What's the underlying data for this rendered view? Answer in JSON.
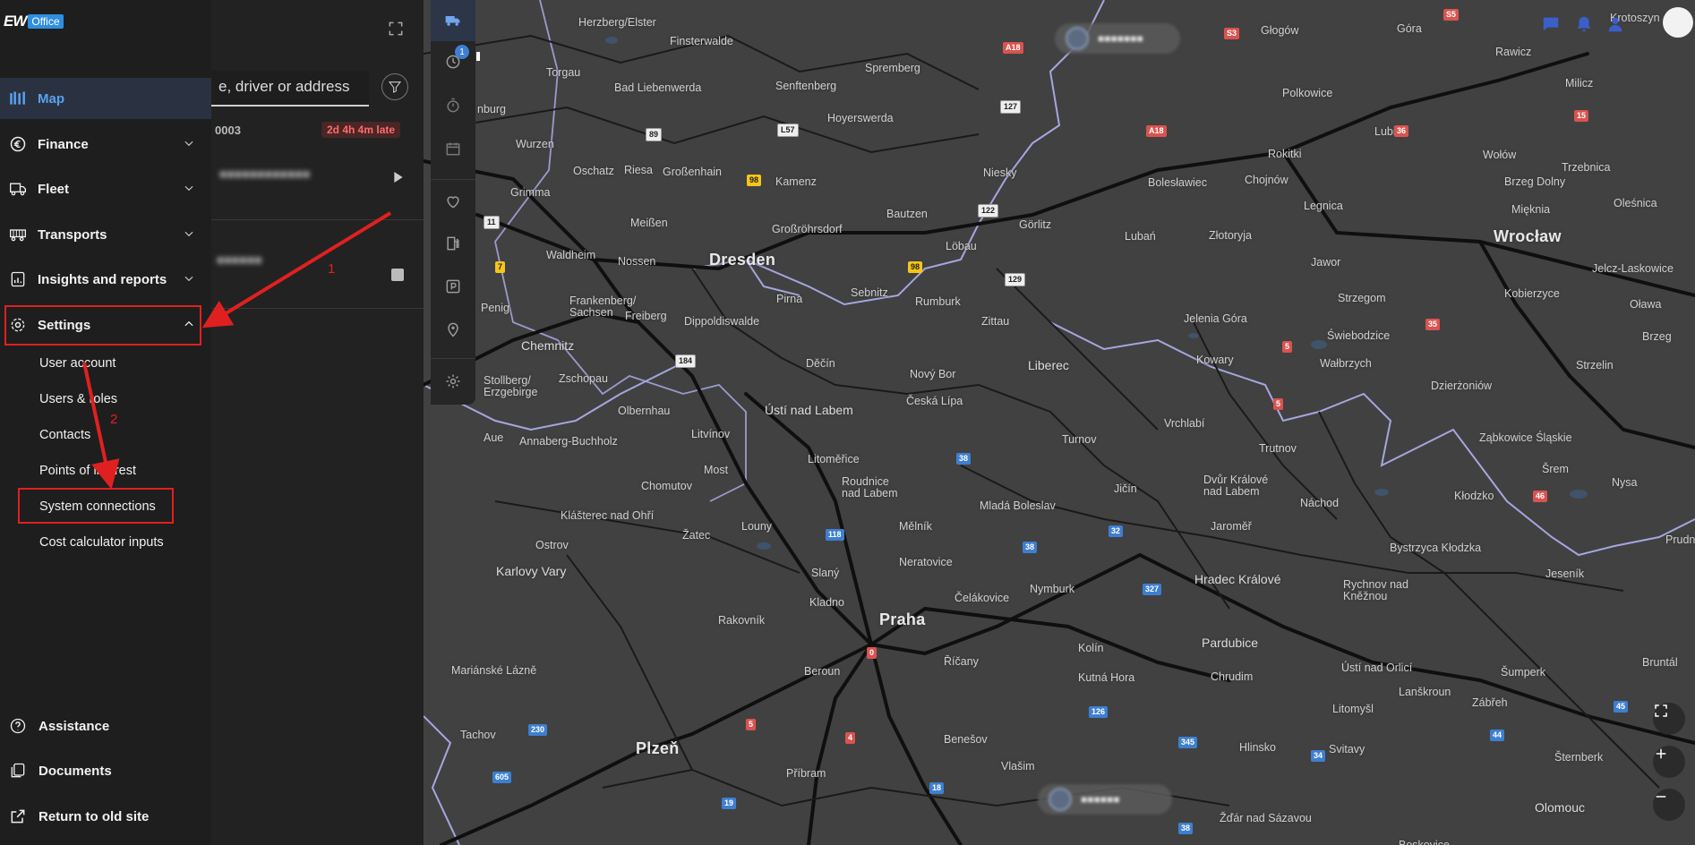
{
  "brand": {
    "logo_text": "EW",
    "product": "Office"
  },
  "sidebar": {
    "items": [
      {
        "id": "map",
        "label": "Map",
        "icon": "map-icon",
        "active": true
      },
      {
        "id": "finance",
        "label": "Finance",
        "icon": "euro-icon"
      },
      {
        "id": "fleet",
        "label": "Fleet",
        "icon": "truck-icon"
      },
      {
        "id": "transports",
        "label": "Transports",
        "icon": "trailer-icon"
      },
      {
        "id": "insights",
        "label": "Insights and reports",
        "icon": "report-icon"
      },
      {
        "id": "settings",
        "label": "Settings",
        "icon": "gear-icon",
        "expanded": true
      }
    ],
    "settings_sub": [
      "User account",
      "Users & roles",
      "Contacts",
      "Points of interest",
      "System connections",
      "Cost calculator inputs"
    ],
    "bottom": [
      {
        "label": "Assistance",
        "icon": "help-icon"
      },
      {
        "label": "Documents",
        "icon": "documents-icon"
      },
      {
        "label": "Return to old site",
        "icon": "external-link-icon"
      }
    ]
  },
  "panel": {
    "search_placeholder": "e, driver or address",
    "order_id": "0003",
    "late_badge": "2d 4h 4m late",
    "rail_badge": "1"
  },
  "annotations": {
    "step1": "1",
    "step2": "2"
  },
  "colors": {
    "accent": "#5aa0f0",
    "annotation": "#e02020",
    "badge_late": "#ff6b6b"
  },
  "map": {
    "cities": [
      [
        "Herzberg/Elster",
        646,
        19,
        ""
      ],
      [
        "Finsterwalde",
        748,
        40,
        ""
      ],
      [
        "Głogów",
        1408,
        28,
        ""
      ],
      [
        "Góra",
        1560,
        26,
        ""
      ],
      [
        "Krotoszyn",
        1798,
        14,
        ""
      ],
      [
        "Torgau",
        610,
        75,
        ""
      ],
      [
        "Bad Liebenwerda",
        686,
        92,
        ""
      ],
      [
        "Senftenberg",
        866,
        90,
        ""
      ],
      [
        "Spremberg",
        966,
        70,
        ""
      ],
      [
        "Rawicz",
        1670,
        52,
        ""
      ],
      [
        "Hoyerswerda",
        924,
        126,
        ""
      ],
      [
        "Polkowice",
        1432,
        98,
        ""
      ],
      [
        "Milicz",
        1748,
        87,
        ""
      ],
      [
        "nburg",
        533,
        116,
        ""
      ],
      [
        "Wurzen",
        576,
        155,
        ""
      ],
      [
        "Oschatz",
        640,
        185,
        ""
      ],
      [
        "Riesa",
        697,
        184,
        ""
      ],
      [
        "Großenhain",
        740,
        186,
        ""
      ],
      [
        "Kamenz",
        866,
        197,
        ""
      ],
      [
        "Niesky",
        1098,
        187,
        ""
      ],
      [
        "Bolesławiec",
        1282,
        198,
        ""
      ],
      [
        "Chojnów",
        1390,
        195,
        ""
      ],
      [
        "Rokitki",
        1416,
        166,
        ""
      ],
      [
        "Lubin",
        1535,
        141,
        ""
      ],
      [
        "Wołów",
        1656,
        167,
        ""
      ],
      [
        "Trzebnica",
        1744,
        181,
        ""
      ],
      [
        "Brzeg Dolny",
        1680,
        197,
        ""
      ],
      [
        "Oleśnica",
        1802,
        221,
        ""
      ],
      [
        "Grimma",
        570,
        209,
        ""
      ],
      [
        "Bautzen",
        990,
        233,
        ""
      ],
      [
        "Legnica",
        1456,
        224,
        ""
      ],
      [
        "Mięknia",
        1688,
        228,
        ""
      ],
      [
        "Meißen",
        704,
        243,
        ""
      ],
      [
        "Großröhrsdorf",
        862,
        250,
        ""
      ],
      [
        "Löbau",
        1056,
        269,
        ""
      ],
      [
        "Görlitz",
        1138,
        245,
        ""
      ],
      [
        "Lubań",
        1256,
        258,
        ""
      ],
      [
        "Złotoryja",
        1350,
        257,
        ""
      ],
      [
        "Waldheim",
        610,
        279,
        ""
      ],
      [
        "Nossen",
        690,
        286,
        ""
      ],
      [
        "Dresden",
        792,
        284,
        "big"
      ],
      [
        "Jawor",
        1464,
        287,
        ""
      ],
      [
        "Wrocław",
        1668,
        258,
        "big"
      ],
      [
        "Jelcz-Laskowice",
        1778,
        294,
        ""
      ],
      [
        "Pirna",
        867,
        328,
        ""
      ],
      [
        "Sebnitz",
        950,
        321,
        ""
      ],
      [
        "Rumburk",
        1022,
        331,
        ""
      ],
      [
        "Strzegom",
        1494,
        327,
        ""
      ],
      [
        "Kobierzyce",
        1680,
        322,
        ""
      ],
      [
        "Oława",
        1820,
        334,
        ""
      ],
      [
        "Frankenberg/\nSachsen",
        636,
        330,
        ""
      ],
      [
        "Freiberg",
        698,
        347,
        ""
      ],
      [
        "Dippoldiswalde",
        764,
        353,
        ""
      ],
      [
        "Zittau",
        1096,
        353,
        ""
      ],
      [
        "Jelenia Góra",
        1322,
        350,
        ""
      ],
      [
        "Świebodzice",
        1482,
        369,
        ""
      ],
      [
        "Brzeg",
        1834,
        370,
        ""
      ],
      [
        "Penig",
        537,
        338,
        ""
      ],
      [
        "Chemnitz",
        582,
        380,
        "mid"
      ],
      [
        "Liberec",
        1148,
        402,
        "mid"
      ],
      [
        "Kowary",
        1336,
        396,
        ""
      ],
      [
        "Wałbrzych",
        1474,
        400,
        ""
      ],
      [
        "Strzelin",
        1760,
        402,
        ""
      ],
      [
        "Zschopau",
        624,
        417,
        ""
      ],
      [
        "Děčín",
        900,
        400,
        ""
      ],
      [
        "Nový Bor",
        1016,
        412,
        ""
      ],
      [
        "Stollberg/\nErzgebirge",
        540,
        419,
        ""
      ],
      [
        "Dzierżoniów",
        1598,
        425,
        ""
      ],
      [
        "Olbernhau",
        690,
        453,
        ""
      ],
      [
        "Ústí nad Labem",
        854,
        452,
        "mid"
      ],
      [
        "Česká Lípa",
        1012,
        442,
        ""
      ],
      [
        "Vrchlabí",
        1300,
        467,
        ""
      ],
      [
        "Aue",
        540,
        483,
        ""
      ],
      [
        "Annaberg-Buchholz",
        580,
        487,
        ""
      ],
      [
        "Litvínov",
        772,
        479,
        ""
      ],
      [
        "Turnov",
        1186,
        485,
        ""
      ],
      [
        "Trutnov",
        1406,
        495,
        ""
      ],
      [
        "Ząbkowice Śląskie",
        1652,
        483,
        ""
      ],
      [
        "Most",
        786,
        519,
        ""
      ],
      [
        "Litoměřice",
        902,
        507,
        ""
      ],
      [
        "Roudnice\nnad Labem",
        940,
        532,
        ""
      ],
      [
        "Jičín",
        1244,
        540,
        ""
      ],
      [
        "Dvůr Králové\nnad Labem",
        1344,
        530,
        ""
      ],
      [
        "Nysa",
        1800,
        533,
        ""
      ],
      [
        "Šrem",
        1722,
        518,
        ""
      ],
      [
        "Chomutov",
        716,
        537,
        ""
      ],
      [
        "Klášterec nad Ohří",
        626,
        570,
        ""
      ],
      [
        "Mladá Boleslav",
        1094,
        559,
        ""
      ],
      [
        "Náchod",
        1452,
        556,
        ""
      ],
      [
        "Kłodzko",
        1624,
        548,
        ""
      ],
      [
        "Žatec",
        762,
        592,
        ""
      ],
      [
        "Louny",
        828,
        582,
        ""
      ],
      [
        "Mělník",
        1004,
        582,
        ""
      ],
      [
        "Jaroměř",
        1352,
        582,
        ""
      ],
      [
        "Ostrov",
        598,
        603,
        ""
      ],
      [
        "Bystrzyca Kłodzka",
        1552,
        606,
        ""
      ],
      [
        "Prudnik",
        1860,
        597,
        ""
      ],
      [
        "Karlovy Vary",
        554,
        632,
        "mid"
      ],
      [
        "Neratovice",
        1004,
        622,
        ""
      ],
      [
        "Slaný",
        906,
        634,
        ""
      ],
      [
        "Hradec Králové",
        1334,
        641,
        "mid"
      ],
      [
        "Jeseník",
        1726,
        635,
        ""
      ],
      [
        "Kladno",
        904,
        667,
        ""
      ],
      [
        "Čelákovice",
        1066,
        662,
        ""
      ],
      [
        "Nymburk",
        1150,
        652,
        ""
      ],
      [
        "Rychnov nad\nKněžnou",
        1500,
        647,
        ""
      ],
      [
        "Rakovník",
        802,
        687,
        ""
      ],
      [
        "Praha",
        982,
        686,
        "big"
      ],
      [
        "Kolín",
        1204,
        718,
        ""
      ],
      [
        "Pardubice",
        1342,
        712,
        "mid"
      ],
      [
        "Mariánské Lázně",
        504,
        743,
        ""
      ],
      [
        "Beroun",
        898,
        744,
        ""
      ],
      [
        "Říčany",
        1054,
        733,
        ""
      ],
      [
        "Kutná Hora",
        1204,
        751,
        ""
      ],
      [
        "Chrudim",
        1352,
        750,
        ""
      ],
      [
        "Ústí nad Orlicí",
        1498,
        740,
        ""
      ],
      [
        "Šumperk",
        1676,
        745,
        ""
      ],
      [
        "Bruntál",
        1834,
        734,
        ""
      ],
      [
        "Lanškroun",
        1562,
        767,
        ""
      ],
      [
        "Litomyšl",
        1488,
        786,
        ""
      ],
      [
        "Zábřeh",
        1644,
        779,
        ""
      ],
      [
        "Tachov",
        514,
        815,
        ""
      ],
      [
        "Plzeň",
        710,
        830,
        "big"
      ],
      [
        "Benešov",
        1054,
        820,
        ""
      ],
      [
        "Hlinsko",
        1384,
        829,
        ""
      ],
      [
        "Svitavy",
        1484,
        831,
        ""
      ],
      [
        "Šternberk",
        1736,
        840,
        ""
      ],
      [
        "Příbram",
        878,
        858,
        ""
      ],
      [
        "Vlašim",
        1118,
        850,
        ""
      ],
      [
        "Žďár nad Sázavou",
        1362,
        908,
        ""
      ],
      [
        "Olomouc",
        1714,
        896,
        "mid"
      ],
      [
        "Boskovice",
        1562,
        938,
        ""
      ]
    ],
    "shields": [
      [
        "A18",
        1120,
        47,
        "red"
      ],
      [
        "S3",
        1367,
        31,
        "red"
      ],
      [
        "S5",
        1612,
        10,
        "red"
      ],
      [
        "15",
        1758,
        123,
        "red"
      ],
      [
        "36",
        1557,
        140,
        "red"
      ],
      [
        "A18",
        1280,
        140,
        "red"
      ],
      [
        "127",
        1117,
        112,
        "white"
      ],
      [
        "L57",
        868,
        138,
        "white"
      ],
      [
        "89",
        721,
        143,
        "white"
      ],
      [
        "98",
        834,
        195,
        "yellow"
      ],
      [
        "122",
        1092,
        228,
        "white"
      ],
      [
        "11",
        540,
        241,
        "white"
      ],
      [
        "7",
        553,
        292,
        "yellow"
      ],
      [
        "98",
        1014,
        292,
        "yellow"
      ],
      [
        "129",
        1122,
        305,
        "white"
      ],
      [
        "35",
        1592,
        356,
        "red"
      ],
      [
        "5",
        1432,
        381,
        "red"
      ],
      [
        "184",
        754,
        396,
        "white"
      ],
      [
        "5",
        1422,
        445,
        "red"
      ],
      [
        "38",
        1068,
        506,
        "blue"
      ],
      [
        "46",
        1712,
        548,
        "red"
      ],
      [
        "32",
        1238,
        587,
        "blue"
      ],
      [
        "118",
        922,
        591,
        "blue"
      ],
      [
        "38",
        1142,
        605,
        "blue"
      ],
      [
        "327",
        1276,
        652,
        "blue"
      ],
      [
        "0",
        968,
        723,
        "red"
      ],
      [
        "126",
        1216,
        789,
        "blue"
      ],
      [
        "5",
        833,
        803,
        "red"
      ],
      [
        "4",
        944,
        818,
        "red"
      ],
      [
        "345",
        1316,
        823,
        "blue"
      ],
      [
        "230",
        590,
        809,
        "blue"
      ],
      [
        "34",
        1464,
        838,
        "blue"
      ],
      [
        "44",
        1664,
        815,
        "blue"
      ],
      [
        "45",
        1802,
        783,
        "blue"
      ],
      [
        "605",
        550,
        862,
        "blue"
      ],
      [
        "18",
        1038,
        874,
        "blue"
      ],
      [
        "19",
        806,
        891,
        "blue"
      ],
      [
        "38",
        1316,
        919,
        "blue"
      ]
    ]
  }
}
